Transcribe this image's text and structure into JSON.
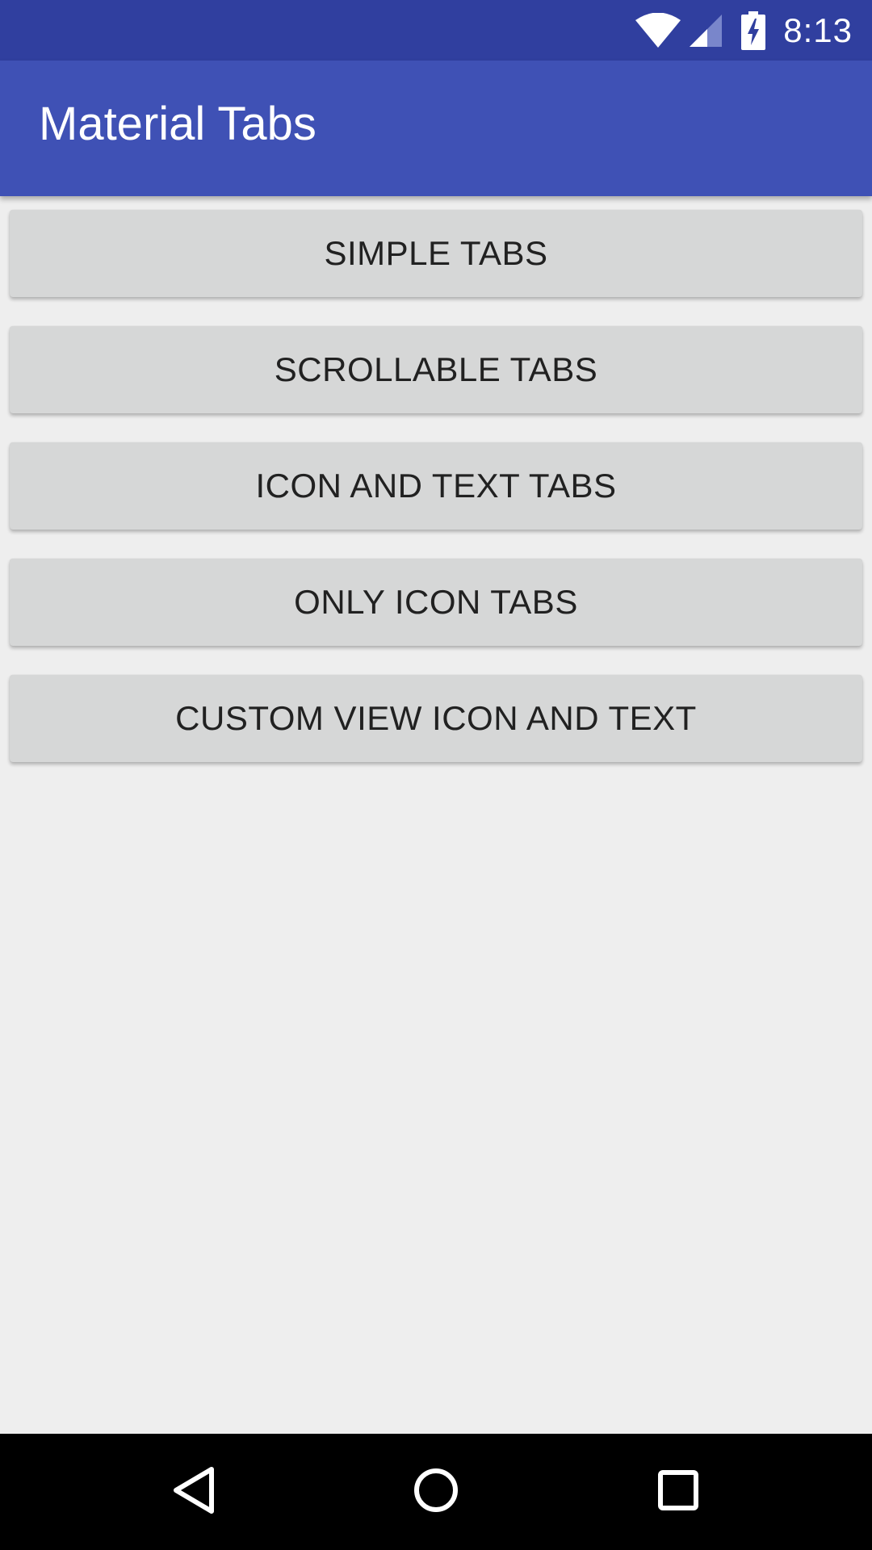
{
  "status_bar": {
    "time": "8:13",
    "icons": [
      "wifi-icon",
      "signal-icon",
      "battery-charging-icon"
    ],
    "background": "#303f9f"
  },
  "app_bar": {
    "title": "Material Tabs",
    "background": "#3f51b5"
  },
  "buttons": [
    {
      "label": "SIMPLE TABS"
    },
    {
      "label": "SCROLLABLE TABS"
    },
    {
      "label": "ICON AND TEXT TABS"
    },
    {
      "label": "ONLY ICON TABS"
    },
    {
      "label": "CUSTOM VIEW ICON AND TEXT"
    }
  ],
  "nav_bar": {
    "icons": [
      "back-icon",
      "home-icon",
      "recents-icon"
    ],
    "background": "#000000"
  },
  "colors": {
    "button_bg": "#d6d7d7",
    "button_text": "#212121",
    "page_bg": "#eeeeee"
  }
}
